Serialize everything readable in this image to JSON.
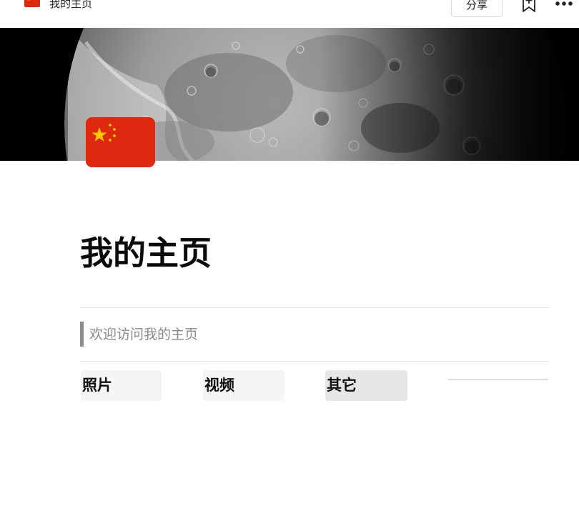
{
  "topbar": {
    "page_title": "我的主页",
    "share_label": "分享",
    "bookmark_icon": "bookmark-add-icon",
    "more_icon": "more-dots-icon"
  },
  "cover": {
    "image": "moon-surface-cover"
  },
  "page_icon": "china-flag-icon",
  "page": {
    "title": "我的主页",
    "quote": "欢迎访问我的主页"
  },
  "tabs": [
    {
      "label": "照片"
    },
    {
      "label": "视频"
    },
    {
      "label": "其它"
    }
  ],
  "colors": {
    "flag_red": "#de2910",
    "flag_star": "#ffde00",
    "quote_bar": "#8c8c8c",
    "active_tab": "#e6e6e6",
    "tab_bg": "#f5f5f5"
  }
}
